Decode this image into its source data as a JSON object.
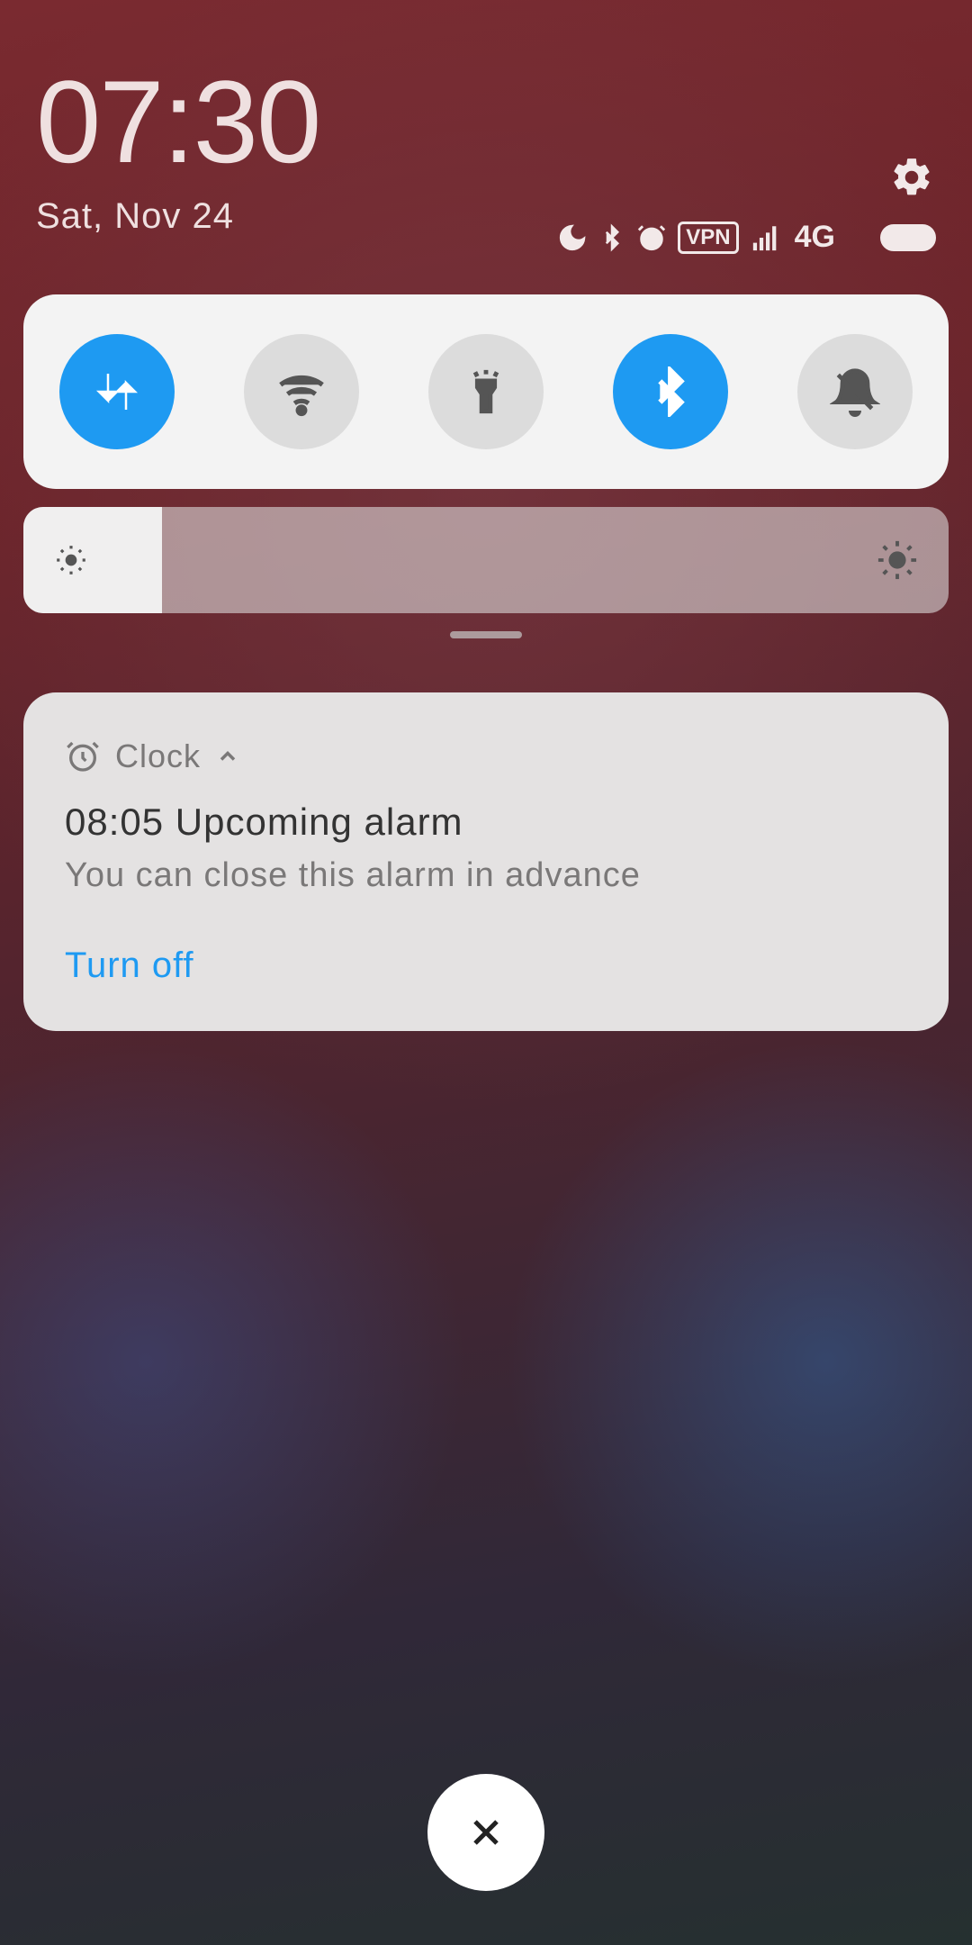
{
  "header": {
    "time": "07:30",
    "date": "Sat, Nov 24"
  },
  "status": {
    "dnd": "moon",
    "bluetooth": true,
    "alarm": true,
    "vpn": "VPN",
    "signal": "full",
    "network": "4G",
    "battery": "full"
  },
  "quick_settings": {
    "toggles": [
      {
        "name": "mobile-data",
        "active": true,
        "icon": "data-arrows"
      },
      {
        "name": "wifi",
        "active": false,
        "icon": "wifi"
      },
      {
        "name": "flashlight",
        "active": false,
        "icon": "flashlight"
      },
      {
        "name": "bluetooth",
        "active": true,
        "icon": "bluetooth"
      },
      {
        "name": "dnd",
        "active": false,
        "icon": "bell-off"
      }
    ]
  },
  "brightness": {
    "percent": 15
  },
  "notification": {
    "app": "Clock",
    "title": "08:05 Upcoming alarm",
    "body": "You can close this alarm in advance",
    "action": "Turn off"
  }
}
